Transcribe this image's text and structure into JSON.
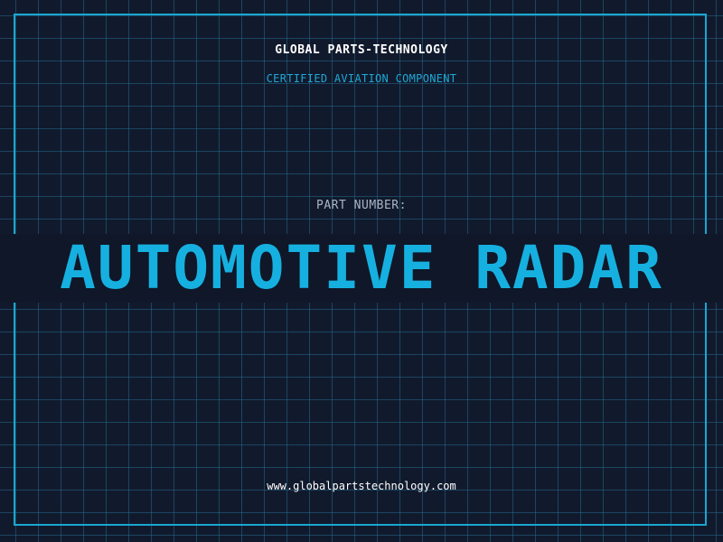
{
  "brand": {
    "name": "GLOBAL PARTS-TECHNOLOGY",
    "tagline": "CERTIFIED AVIATION COMPONENT"
  },
  "part": {
    "label": "PART NUMBER:",
    "name": "AUTOMOTIVE RADAR"
  },
  "footer": {
    "url": "www.globalpartstechnology.com"
  },
  "colors": {
    "background": "#111a2c",
    "grid": "#1f5a78",
    "accent": "#16b0e0",
    "text": "#ffffff"
  }
}
